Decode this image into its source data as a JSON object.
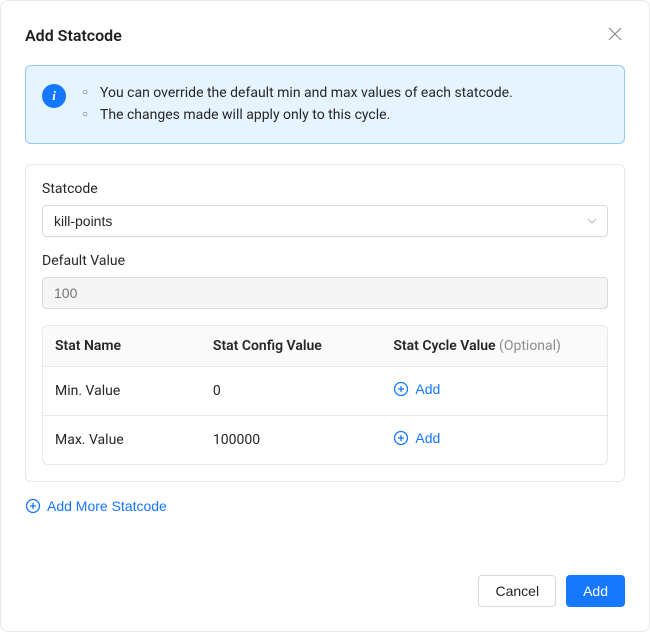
{
  "modal": {
    "title": "Add Statcode",
    "info": {
      "line1": "You can override the default min and max values of each statcode.",
      "line2": "The changes made will apply only to this cycle."
    },
    "form": {
      "statcode": {
        "label": "Statcode",
        "value": "kill-points"
      },
      "default_value": {
        "label": "Default Value",
        "placeholder": "100"
      }
    },
    "table": {
      "headers": {
        "stat_name": "Stat Name",
        "config_value": "Stat Config Value",
        "cycle_value": "Stat Cycle Value",
        "optional_suffix": " (Optional)"
      },
      "rows": [
        {
          "name": "Min. Value",
          "config": "0",
          "add_label": "Add"
        },
        {
          "name": "Max. Value",
          "config": "100000",
          "add_label": "Add"
        }
      ]
    },
    "add_more_label": "Add More Statcode",
    "footer": {
      "cancel": "Cancel",
      "add": "Add"
    }
  }
}
